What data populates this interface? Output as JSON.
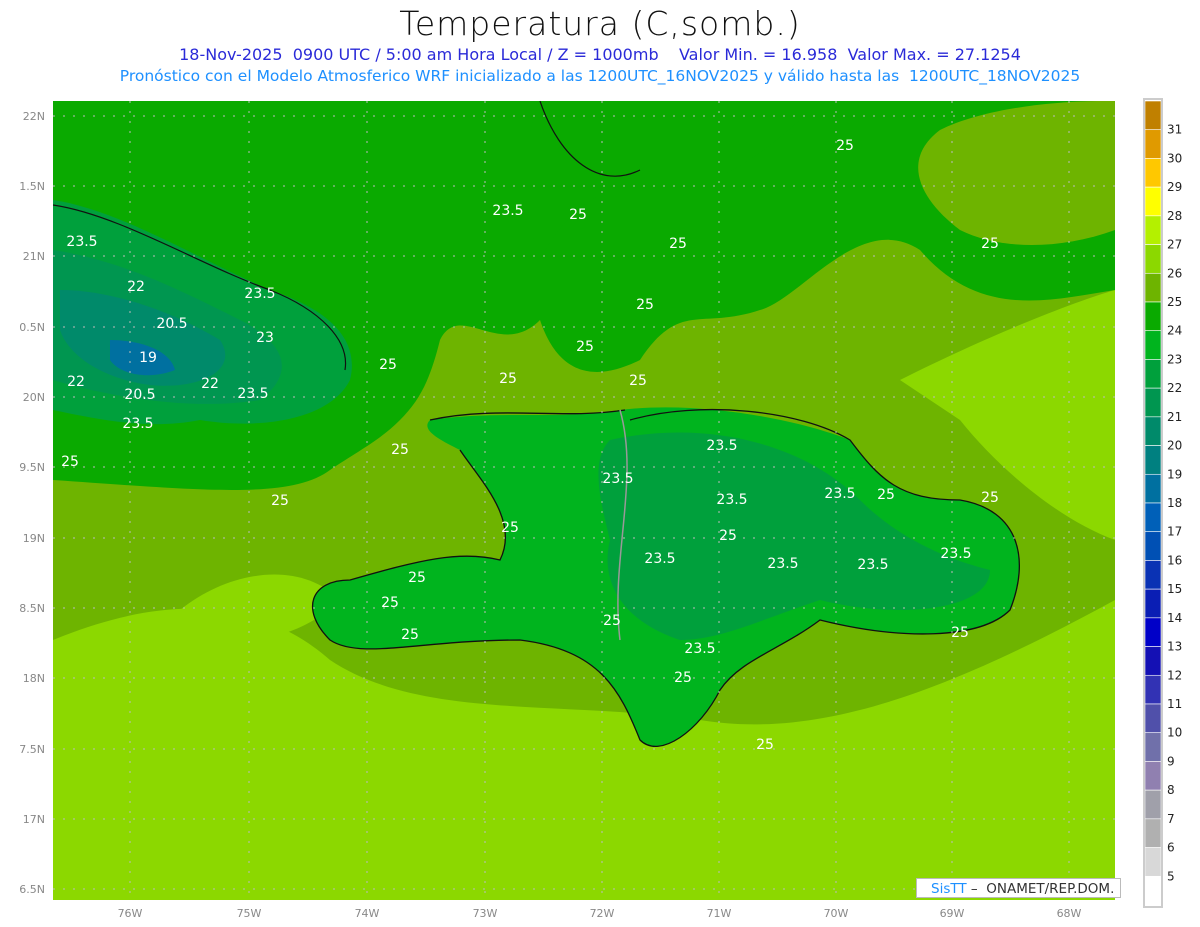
{
  "header": {
    "title": "Temperatura (C,somb.)",
    "subtitle1": "18-Nov-2025  0900 UTC / 5:00 am Hora Local / Z = 1000mb    Valor Min. = 16.958  Valor Max. = 27.1254",
    "subtitle2": "Pronóstico con el Modelo Atmosferico WRF inicializado a las 1200UTC_16NOV2025 y válido hasta las  1200UTC_18NOV2025"
  },
  "map": {
    "lat_labels": [
      "22N",
      "1.5N",
      "21N",
      "0.5N",
      "20N",
      "9.5N",
      "19N",
      "8.5N",
      "18N",
      "7.5N",
      "17N",
      "6.5N"
    ],
    "lon_labels": [
      "76W",
      "75W",
      "74W",
      "73W",
      "72W",
      "71W",
      "70W",
      "69W",
      "68W"
    ],
    "contour_labels": [
      "25",
      "23.5",
      "25",
      "25",
      "25",
      "23.5",
      "22",
      "23.5",
      "25",
      "20.5",
      "23",
      "19",
      "25",
      "25",
      "25",
      "22",
      "20.5",
      "22",
      "23.5",
      "25",
      "23.5",
      "25",
      "23.5",
      "25",
      "23.5",
      "23.5",
      "25",
      "23.5",
      "25",
      "25",
      "25",
      "25",
      "23.5",
      "23.5",
      "23.5",
      "23.5",
      "25",
      "25",
      "25",
      "25",
      "23.5",
      "25",
      "25",
      "25"
    ]
  },
  "colorbar": {
    "labels": [
      "31",
      "30",
      "29",
      "28",
      "27",
      "26",
      "25",
      "24",
      "23",
      "22",
      "21",
      "20",
      "19",
      "18",
      "17",
      "16",
      "15",
      "14",
      "13",
      "12",
      "11",
      "10",
      "9",
      "8",
      "7",
      "6",
      "5"
    ],
    "colors": [
      "#c08000",
      "#e09a00",
      "#ffc800",
      "#ffff00",
      "#b4f000",
      "#8cd800",
      "#6eb400",
      "#0aaa00",
      "#00b41e",
      "#00a03c",
      "#009650",
      "#008a6a",
      "#008080",
      "#0070a0",
      "#0060b8",
      "#0050b4",
      "#0a32b4",
      "#0a1eb4",
      "#0000c8",
      "#1410b4",
      "#3232b4",
      "#5050aa",
      "#7070aa",
      "#9080b0",
      "#a0a0aa",
      "#b0b0b0",
      "#d8d8d8",
      "#ffffff"
    ]
  },
  "credit": {
    "logo": "SisTT",
    "text": " –  ONAMET/REP.DOM."
  }
}
